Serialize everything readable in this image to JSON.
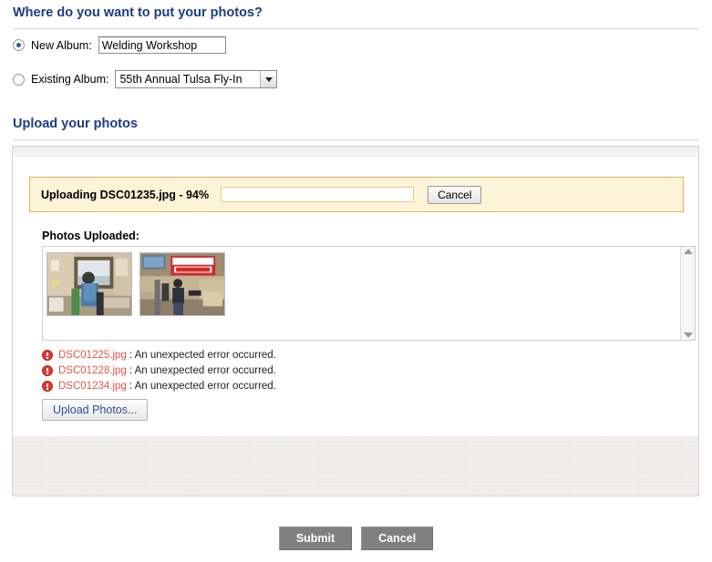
{
  "sections": {
    "where_heading": "Where do you want to put your photos?",
    "upload_heading": "Upload your photos"
  },
  "album": {
    "new_label": "New Album:",
    "new_value": "Welding Workshop",
    "new_placeholder": "",
    "existing_label": "Existing Album:",
    "existing_selected": "55th Annual Tulsa Fly-In"
  },
  "upload": {
    "status_text": "Uploading DSC01235.jpg - 94%",
    "progress_percent": 94,
    "progress_color": "#1b9ad6",
    "cancel_label": "Cancel",
    "photos_uploaded_label": "Photos Uploaded:",
    "upload_photos_label": "Upload Photos...",
    "thumbnails": [
      {
        "alt": "Man in blue shirt standing by workshop window"
      },
      {
        "alt": "Person in workshop beneath Lincoln Electric sign"
      }
    ],
    "errors": [
      {
        "file": "DSC01225.jpg",
        "message": ": An unexpected error occurred."
      },
      {
        "file": "DSC01228.jpg",
        "message": ": An unexpected error occurred."
      },
      {
        "file": "DSC01234.jpg",
        "message": ": An unexpected error occurred."
      }
    ],
    "error_color": "#e2544c"
  },
  "footer": {
    "submit_label": "Submit",
    "cancel_label": "Cancel"
  }
}
